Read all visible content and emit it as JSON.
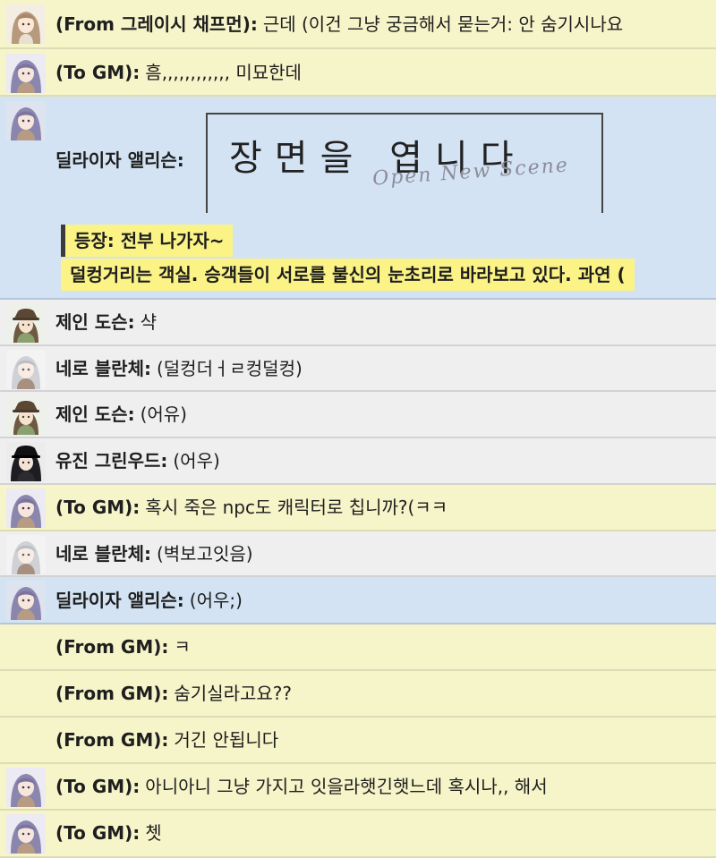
{
  "messages": [
    {
      "sender": "(From 그레이시 채프먼):",
      "text": "근데 (이건 그냥 궁금해서 묻는거: 안 숨기시나요",
      "avatar": "girl-avatar-icon"
    },
    {
      "sender": "(To GM):",
      "text": "흠,,,,,,,,,,,, 미묘한데",
      "avatar": "purple-hair-avatar-icon"
    },
    {
      "sender": "딜라이자 앨리슨:",
      "text": "",
      "avatar": "purple-hair-avatar-icon"
    },
    {
      "sender": "제인 도슨:",
      "text": "샥",
      "avatar": "hat-avatar-icon"
    },
    {
      "sender": "네로 블란체:",
      "text": "(덜컹더ㅓㄹ컹덜컹)",
      "avatar": "white-hair-avatar-icon"
    },
    {
      "sender": "제인 도슨:",
      "text": "(어유)",
      "avatar": "hat-avatar-icon"
    },
    {
      "sender": "유진 그린우드:",
      "text": "(어우)",
      "avatar": "dark-hair-avatar-icon"
    },
    {
      "sender": "(To GM):",
      "text": "혹시 죽은 npc도 캐릭터로 칩니까?(ㅋㅋ",
      "avatar": "purple-hair-avatar-icon"
    },
    {
      "sender": "네로 블란체:",
      "text": "(벽보고잇음)",
      "avatar": "white-hair-avatar-icon"
    },
    {
      "sender": "딜라이자 앨리슨:",
      "text": "(어우;)",
      "avatar": "purple-hair-avatar-icon"
    },
    {
      "sender": "(From GM):",
      "text": "ㅋ"
    },
    {
      "sender": "(From GM):",
      "text": "숨기실라고요??"
    },
    {
      "sender": "(From GM):",
      "text": "거긴 안됩니다"
    },
    {
      "sender": "(To GM):",
      "text": "아니아니 그냥 가지고 잇을라햇긴햇느데 혹시나,, 해서",
      "avatar": "purple-hair-avatar-icon"
    },
    {
      "sender": "(To GM):",
      "text": "쳇",
      "avatar": "purple-hair-avatar-icon"
    }
  ],
  "scene": {
    "title": "장면을 엽니다",
    "subtitle": "Open New Scene",
    "narration_1": "등장: 전부 나가자~",
    "narration_2": "덜컹거리는 객실. 승객들이 서로를 불신의 눈초리로 바라보고 있다. 과연 ("
  },
  "colors": {
    "whisper_row": "#f6f4c9",
    "own_row": "#d3e3f3",
    "other_row": "#efefef",
    "narration_highlight": "#fbf386"
  }
}
